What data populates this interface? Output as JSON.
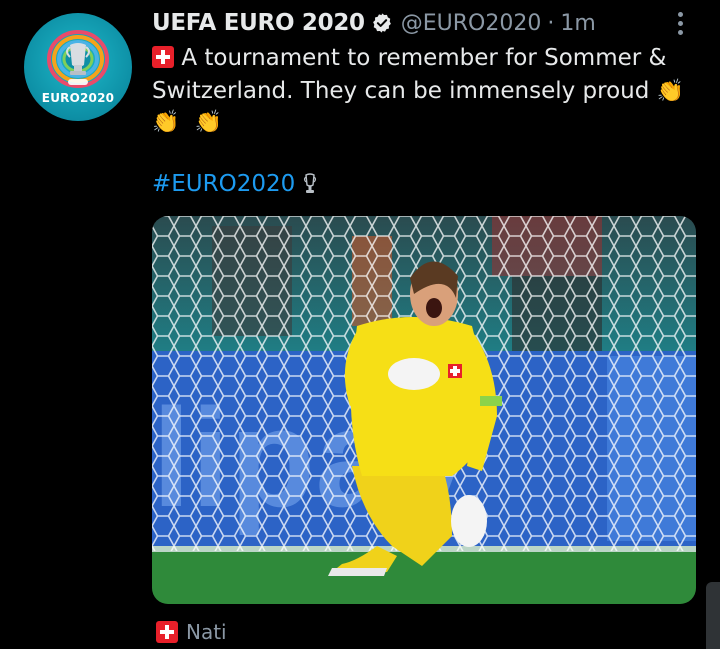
{
  "tweet": {
    "display_name": "UEFA EURO 2020",
    "handle": "@EURO2020",
    "separator": "·",
    "time": "1m",
    "avatar_text": "EURO2020",
    "text_line1": "A tournament to remember for Sommer &",
    "text_line2": "Switzerland. They can be immensely proud",
    "clap_emoji": "👏",
    "hashtag": "#EURO2020",
    "footer_label": "Nati",
    "icons": [
      "verified-badge-icon",
      "more-options-icon",
      "swiss-flag-icon",
      "clapping-hands-icon",
      "trophy-icon"
    ],
    "colors": {
      "background": "#000000",
      "text": "#e7e9ea",
      "secondary_text": "#8b98a5",
      "link": "#1d9bf0",
      "flag_red": "#e8202a",
      "avatar_teal": "#0d8fa5"
    }
  }
}
